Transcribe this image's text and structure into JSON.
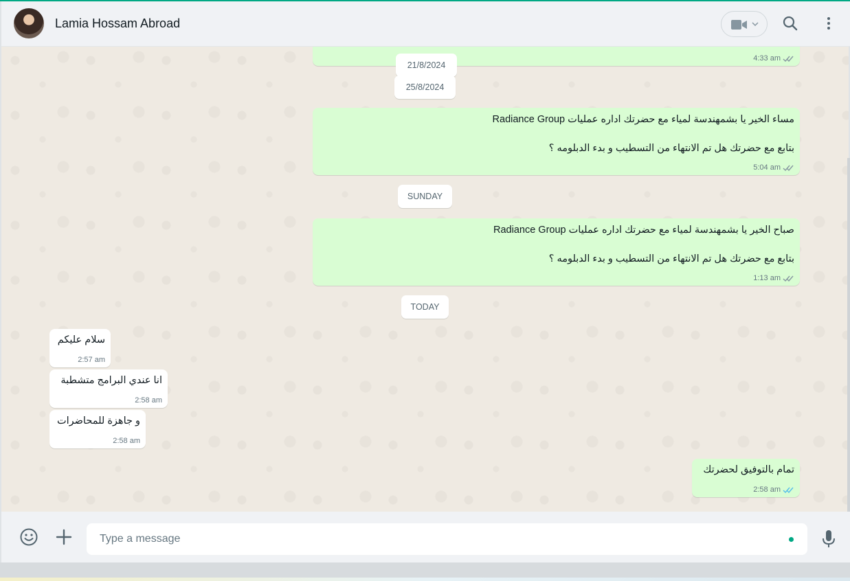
{
  "header": {
    "contact_name": "Lamia Hossam Abroad",
    "icons": [
      "avatar",
      "video-call-icon",
      "chevron-down-icon",
      "search-icon",
      "more-vert-icon"
    ]
  },
  "chat": {
    "top_partial": {
      "time": "4:33 am"
    },
    "chips": {
      "d1": "21/8/2024",
      "d2": "25/8/2024",
      "sunday": "SUNDAY",
      "today": "TODAY"
    },
    "msg1": {
      "line1": "مساء الخير يا بشمهندسة لمياء مع  حضرتك اداره عمليات Radiance Group",
      "line2": "بتابع مع حضرتك هل تم الانتهاء من التسطيب و بدء الدبلومه ؟",
      "time": "5:04 am"
    },
    "msg2": {
      "line1": "صباح الخير يا بشمهندسة لمياء مع  حضرتك اداره عمليات Radiance Group",
      "line2": "بتابع مع حضرتك هل تم الانتهاء من التسطيب و بدء الدبلومه ؟",
      "time": "1:13 am"
    },
    "in1": {
      "text": "سلام عليكم",
      "time": "2:57 am"
    },
    "in2": {
      "text": "انا عندي البرامج متشطبة",
      "time": "2:58 am"
    },
    "in3": {
      "text": "و جاهزة للمحاضرات",
      "time": "2:58 am"
    },
    "msg3": {
      "text": "تمام بالتوفيق لحضرتك",
      "time": "2:58 am"
    }
  },
  "footer": {
    "placeholder": "Type a message"
  },
  "colors": {
    "accent": "#00a884",
    "outgoing_bubble": "#d9fdd3",
    "incoming_bubble": "#ffffff",
    "read_ticks": "#53bdeb",
    "delivered_ticks": "#8696a0"
  }
}
